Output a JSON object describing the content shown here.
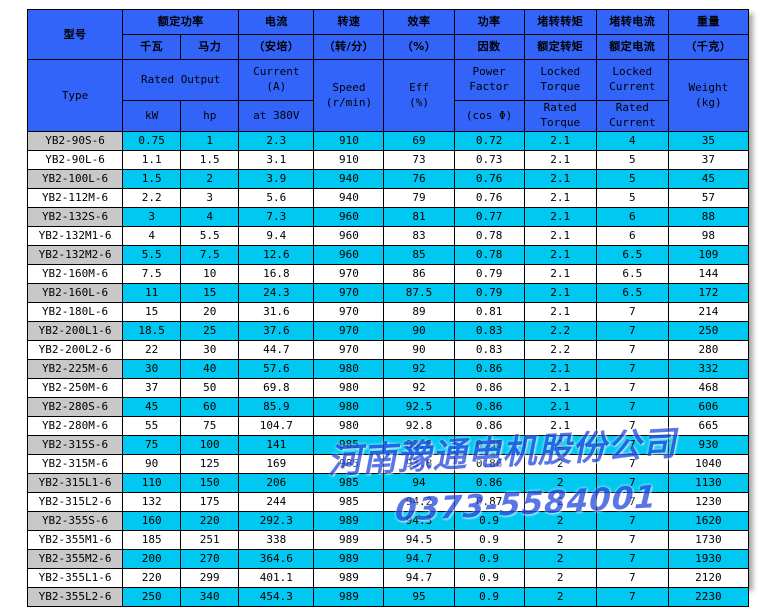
{
  "table": {
    "header": {
      "cn": {
        "model": "型号",
        "rated_power": "额定功率",
        "kw": "千瓦",
        "hp": "马力",
        "current": "电流",
        "current_unit": "（安培）",
        "speed": "转速",
        "speed_unit": "（转/分）",
        "eff": "效率",
        "eff_unit": "（%）",
        "pf": "功率",
        "pf2": "因数",
        "locked_torque": "堵转转矩",
        "rated_torque": "额定转矩",
        "locked_current": "堵转电流",
        "rated_current": "额定电流",
        "weight": "重量",
        "weight_unit": "（千克）"
      },
      "en": {
        "type": "Type",
        "rated_output": "Rated Output",
        "kw": "kW",
        "hp": "hp",
        "current_l1": "Current",
        "current_l2": "(A)",
        "current_l3": "at 380V",
        "speed_l1": "Speed",
        "speed_l2": "(r/min)",
        "eff_l1": "Eff",
        "eff_l2": "(%)",
        "pf_l1": "Power",
        "pf_l2": "Factor",
        "pf_l3": "(cos Φ)",
        "lt_l1": "Locked",
        "lt_l2": "Torque",
        "rt_l1": "Rated",
        "rt_l2": "Torque",
        "lc_l1": "Locked",
        "lc_l2": "Current",
        "rc_l1": "Rated",
        "rc_l2": "Current",
        "w_l1": "Weight",
        "w_l2": "(kg)"
      }
    },
    "columns": [
      "Type",
      "kW",
      "hp",
      "Current (A) at 380V",
      "Speed (r/min)",
      "Eff (%)",
      "Power Factor (cos Φ)",
      "Locked Torque / Rated Torque",
      "Locked Current / Rated Current",
      "Weight (kg)"
    ],
    "rows": [
      [
        "YB2-90S-6",
        "0.75",
        "1",
        "2.3",
        "910",
        "69",
        "0.72",
        "2.1",
        "4",
        "35"
      ],
      [
        "YB2-90L-6",
        "1.1",
        "1.5",
        "3.1",
        "910",
        "73",
        "0.73",
        "2.1",
        "5",
        "37"
      ],
      [
        "YB2-100L-6",
        "1.5",
        "2",
        "3.9",
        "940",
        "76",
        "0.76",
        "2.1",
        "5",
        "45"
      ],
      [
        "YB2-112M-6",
        "2.2",
        "3",
        "5.6",
        "940",
        "79",
        "0.76",
        "2.1",
        "5",
        "57"
      ],
      [
        "YB2-132S-6",
        "3",
        "4",
        "7.3",
        "960",
        "81",
        "0.77",
        "2.1",
        "6",
        "88"
      ],
      [
        "YB2-132M1-6",
        "4",
        "5.5",
        "9.4",
        "960",
        "83",
        "0.78",
        "2.1",
        "6",
        "98"
      ],
      [
        "YB2-132M2-6",
        "5.5",
        "7.5",
        "12.6",
        "960",
        "85",
        "0.78",
        "2.1",
        "6.5",
        "109"
      ],
      [
        "YB2-160M-6",
        "7.5",
        "10",
        "16.8",
        "970",
        "86",
        "0.79",
        "2.1",
        "6.5",
        "144"
      ],
      [
        "YB2-160L-6",
        "11",
        "15",
        "24.3",
        "970",
        "87.5",
        "0.79",
        "2.1",
        "6.5",
        "172"
      ],
      [
        "YB2-180L-6",
        "15",
        "20",
        "31.6",
        "970",
        "89",
        "0.81",
        "2.1",
        "7",
        "214"
      ],
      [
        "YB2-200L1-6",
        "18.5",
        "25",
        "37.6",
        "970",
        "90",
        "0.83",
        "2.2",
        "7",
        "250"
      ],
      [
        "YB2-200L2-6",
        "22",
        "30",
        "44.7",
        "970",
        "90",
        "0.83",
        "2.2",
        "7",
        "280"
      ],
      [
        "YB2-225M-6",
        "30",
        "40",
        "57.6",
        "980",
        "92",
        "0.86",
        "2.1",
        "7",
        "332"
      ],
      [
        "YB2-250M-6",
        "37",
        "50",
        "69.8",
        "980",
        "92",
        "0.86",
        "2.1",
        "7",
        "468"
      ],
      [
        "YB2-280S-6",
        "45",
        "60",
        "85.9",
        "980",
        "92.5",
        "0.86",
        "2.1",
        "7",
        "606"
      ],
      [
        "YB2-280M-6",
        "55",
        "75",
        "104.7",
        "980",
        "92.8",
        "0.86",
        "2.1",
        "7",
        "665"
      ],
      [
        "YB2-315S-6",
        "75",
        "100",
        "141",
        "985",
        "93.5",
        "0.86",
        "2",
        "7",
        "930"
      ],
      [
        "YB2-315M-6",
        "90",
        "125",
        "169",
        "985",
        "93.8",
        "0.86",
        "2",
        "7",
        "1040"
      ],
      [
        "YB2-315L1-6",
        "110",
        "150",
        "206",
        "985",
        "94",
        "0.86",
        "2",
        "7",
        "1130"
      ],
      [
        "YB2-315L2-6",
        "132",
        "175",
        "244",
        "985",
        "94.2",
        "0.87",
        "2",
        "7",
        "1230"
      ],
      [
        "YB2-355S-6",
        "160",
        "220",
        "292.3",
        "989",
        "94.3",
        "0.9",
        "2",
        "7",
        "1620"
      ],
      [
        "YB2-355M1-6",
        "185",
        "251",
        "338",
        "989",
        "94.5",
        "0.9",
        "2",
        "7",
        "1730"
      ],
      [
        "YB2-355M2-6",
        "200",
        "270",
        "364.6",
        "989",
        "94.7",
        "0.9",
        "2",
        "7",
        "1930"
      ],
      [
        "YB2-355L1-6",
        "220",
        "299",
        "401.1",
        "989",
        "94.7",
        "0.9",
        "2",
        "7",
        "2120"
      ],
      [
        "YB2-355L2-6",
        "250",
        "340",
        "454.3",
        "989",
        "95",
        "0.9",
        "2",
        "7",
        "2230"
      ]
    ]
  },
  "watermark": {
    "company": "河南豫通电机股份公司",
    "phone": "0373-5584001",
    "color": "#2b4fe0"
  },
  "colors": {
    "header_blue": "#3264fa",
    "row_cyan": "#00c8f0",
    "row_gray": "#c8c8c8",
    "row_white": "#ffffff",
    "border": "#000000"
  }
}
